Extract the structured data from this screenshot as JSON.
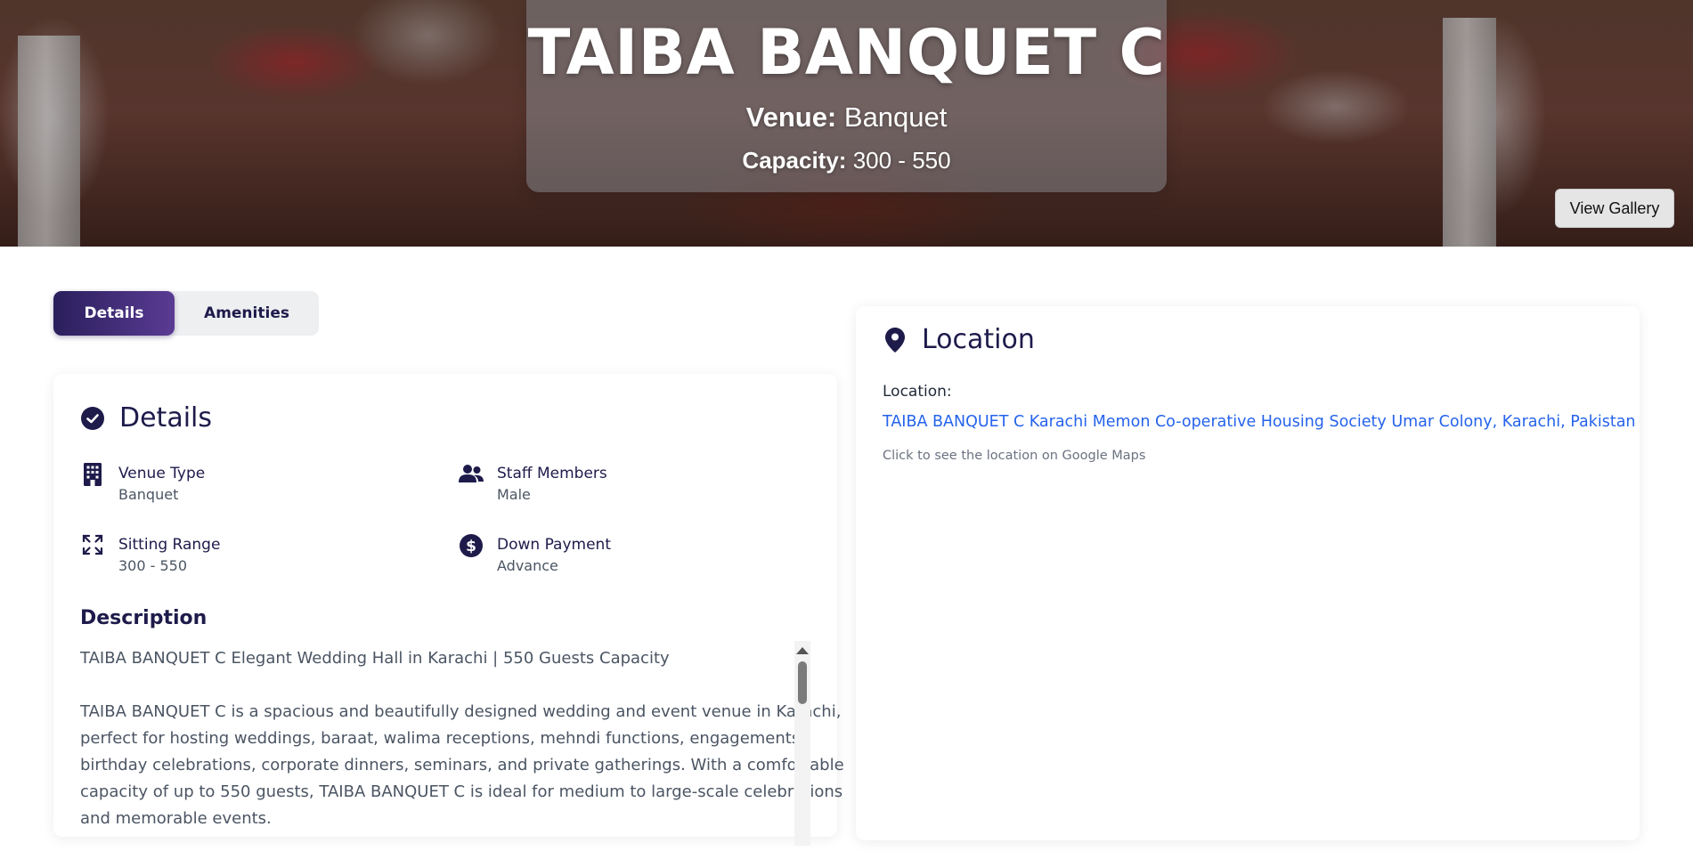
{
  "hero": {
    "title": "TAIBA BANQUET C",
    "venue_label": "Venue:",
    "venue_value": "Banquet",
    "capacity_label": "Capacity:",
    "capacity_value": "300 - 550",
    "gallery_button": "View Gallery"
  },
  "tabs": [
    {
      "label": "Details",
      "active": true
    },
    {
      "label": "Amenities",
      "active": false
    }
  ],
  "details": {
    "title": "Details",
    "items": [
      {
        "icon": "building-icon",
        "label": "Venue Type",
        "value": "Banquet"
      },
      {
        "icon": "users-icon",
        "label": "Staff Members",
        "value": "Male"
      },
      {
        "icon": "expand-icon",
        "label": "Sitting Range",
        "value": "300 - 550"
      },
      {
        "icon": "dollar-icon",
        "label": "Down Payment",
        "value": "Advance"
      }
    ],
    "description_title": "Description",
    "description": [
      "TAIBA BANQUET C Elegant Wedding Hall in Karachi | 550 Guests Capacity",
      "TAIBA BANQUET C is a spacious and beautifully designed wedding and event venue in Karachi, perfect for hosting weddings, baraat, walima receptions, mehndi functions, engagements, birthday celebrations, corporate dinners, seminars, and private gatherings. With a comfortable capacity of up to 550 guests, TAIBA BANQUET C is ideal for medium to large-scale celebrations and memorable events."
    ]
  },
  "location": {
    "title": "Location",
    "label": "Location:",
    "link": "TAIBA BANQUET C Karachi Memon Co-operative Housing Society Umar Colony, Karachi, Pakistan",
    "hint": "Click to see the location on Google Maps"
  },
  "colors": {
    "primary": "#1e1b4b",
    "tab_gradient_start": "#2a1f5c",
    "tab_gradient_end": "#5a3b93",
    "link": "#2563eb"
  }
}
